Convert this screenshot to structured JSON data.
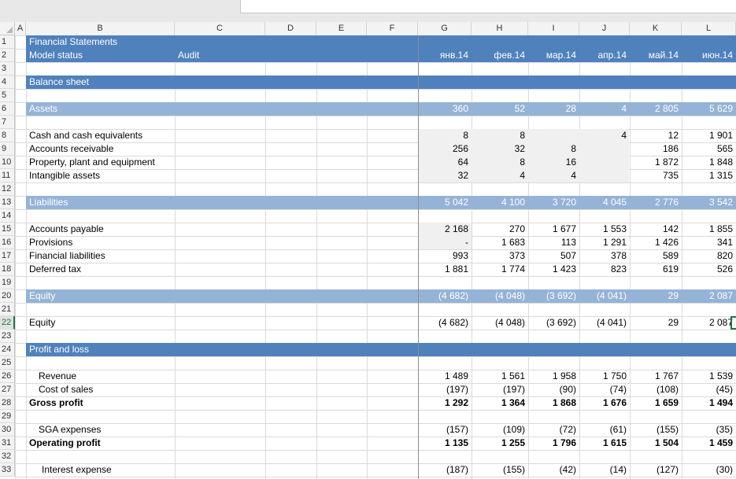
{
  "columns": [
    "A",
    "B",
    "C",
    "D",
    "E",
    "F",
    "G",
    "H",
    "I",
    "J",
    "K",
    "L"
  ],
  "rows": [
    "1",
    "2",
    "3",
    "4",
    "5",
    "6",
    "7",
    "8",
    "9",
    "10",
    "11",
    "12",
    "13",
    "14",
    "15",
    "16",
    "17",
    "18",
    "19",
    "20",
    "21",
    "22",
    "23",
    "24",
    "25",
    "26",
    "27",
    "28",
    "29",
    "30",
    "31",
    "32",
    "33"
  ],
  "selected_row": "22",
  "header": {
    "title": "Financial Statements",
    "model_status_label": "Model status",
    "model_status_value": "Audit",
    "months": [
      "янв.14",
      "фев.14",
      "мар.14",
      "апр.14",
      "май.14",
      "июн.14"
    ]
  },
  "sections": {
    "balance_sheet": "Balance sheet",
    "profit_and_loss": "Profit and loss"
  },
  "assets": {
    "label": "Assets",
    "totals": [
      "360",
      "52",
      "28",
      "4",
      "2 805",
      "5 629"
    ],
    "items": [
      {
        "label": "Cash and cash equivalents",
        "values": [
          "8",
          "8",
          "",
          "4",
          "12",
          "1 901"
        ]
      },
      {
        "label": "Accounts receivable",
        "values": [
          "256",
          "32",
          "8",
          "",
          "186",
          "565"
        ]
      },
      {
        "label": "Property, plant and equipment",
        "values": [
          "64",
          "8",
          "16",
          "",
          "1 872",
          "1 848"
        ]
      },
      {
        "label": "Intangible assets",
        "values": [
          "32",
          "4",
          "4",
          "",
          "735",
          "1 315"
        ]
      }
    ]
  },
  "liabilities": {
    "label": "Liabilities",
    "totals": [
      "5 042",
      "4 100",
      "3 720",
      "4 045",
      "2 776",
      "3 542"
    ],
    "items": [
      {
        "label": "Accounts payable",
        "values": [
          "2 168",
          "270",
          "1 677",
          "1 553",
          "142",
          "1 855"
        ]
      },
      {
        "label": "Provisions",
        "values": [
          "-",
          "1 683",
          "113",
          "1 291",
          "1 426",
          "341"
        ]
      },
      {
        "label": "Financial liabilities",
        "values": [
          "993",
          "373",
          "507",
          "378",
          "589",
          "820"
        ]
      },
      {
        "label": "Deferred tax",
        "values": [
          "1 881",
          "1 774",
          "1 423",
          "823",
          "619",
          "526"
        ]
      }
    ]
  },
  "equity": {
    "label": "Equity",
    "totals": [
      "(4 682)",
      "(4 048)",
      "(3 692)",
      "(4 041)",
      "29",
      "2 087"
    ],
    "item_label": "Equity",
    "item_values": [
      "(4 682)",
      "(4 048)",
      "(3 692)",
      "(4 041)",
      "29",
      "2 087"
    ]
  },
  "pnl": {
    "revenue": {
      "label": "Revenue",
      "values": [
        "1 489",
        "1 561",
        "1 958",
        "1 750",
        "1 767",
        "1 539"
      ]
    },
    "cost_of_sales": {
      "label": "Cost of sales",
      "values": [
        "(197)",
        "(197)",
        "(90)",
        "(74)",
        "(108)",
        "(45)"
      ]
    },
    "gross_profit": {
      "label": "Gross profit",
      "values": [
        "1 292",
        "1 364",
        "1 868",
        "1 676",
        "1 659",
        "1 494"
      ]
    },
    "sga": {
      "label": "SGA expenses",
      "values": [
        "(157)",
        "(109)",
        "(72)",
        "(61)",
        "(155)",
        "(35)"
      ]
    },
    "operating_profit": {
      "label": "Operating profit",
      "values": [
        "1 135",
        "1 255",
        "1 796",
        "1 615",
        "1 504",
        "1 459"
      ]
    },
    "interest": {
      "label": "Interest expense",
      "values": [
        "(187)",
        "(155)",
        "(42)",
        "(14)",
        "(127)",
        "(30)"
      ]
    }
  }
}
